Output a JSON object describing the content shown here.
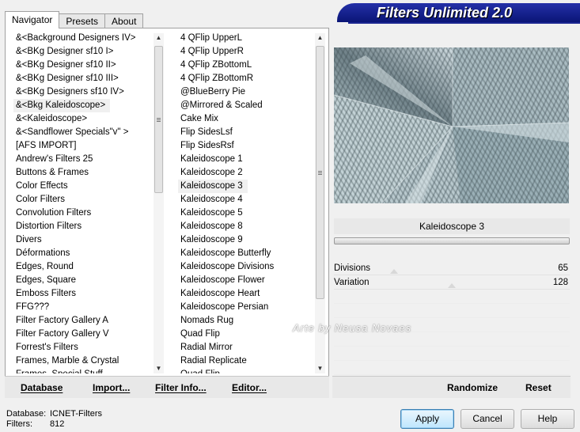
{
  "tabs": [
    "Navigator",
    "Presets",
    "About"
  ],
  "app_title": "Filters Unlimited 2.0",
  "categories": [
    "&<Background Designers IV>",
    "&<BKg Designer sf10 I>",
    "&<BKg Designer sf10 II>",
    "&<BKg Designer sf10 III>",
    "&<BKg Designers sf10 IV>",
    "&<Bkg Kaleidoscope>",
    "&<Kaleidoscope>",
    "&<Sandflower Specials\"v\" >",
    "[AFS IMPORT]",
    "Andrew's Filters 25",
    "Buttons & Frames",
    "Color Effects",
    "Color Filters",
    "Convolution Filters",
    "Distortion Filters",
    "Divers",
    "Déformations",
    "Edges, Round",
    "Edges, Square",
    "Emboss Filters",
    "FFG???",
    "Filter Factory Gallery A",
    "Filter Factory Gallery V",
    "Forrest's Filters",
    "Frames, Marble & Crystal",
    "Frames, Special Stuff"
  ],
  "selected_category": "&<Bkg Kaleidoscope>",
  "filters": [
    "4 QFlip UpperL",
    "4 QFlip UpperR",
    "4 QFlip ZBottomL",
    "4 QFlip ZBottomR",
    "@BlueBerry Pie",
    "@Mirrored & Scaled",
    "Cake Mix",
    "Flip SidesLsf",
    "Flip SidesRsf",
    "Kaleidoscope 1",
    "Kaleidoscope 2",
    "Kaleidoscope 3",
    "Kaleidoscope 4",
    "Kaleidoscope 5",
    "Kaleidoscope 8",
    "Kaleidoscope 9",
    "Kaleidoscope Butterfly",
    "Kaleidoscope Divisions",
    "Kaleidoscope Flower",
    "Kaleidoscope Heart",
    "Kaleidoscope Persian",
    "Nomads Rug",
    "Quad Flip",
    "Radial Mirror",
    "Radial Replicate",
    "Quad Flip"
  ],
  "selected_filter": "Kaleidoscope 3",
  "filter_name": "Kaleidoscope 3",
  "params": [
    {
      "label": "Divisions",
      "value": "65",
      "level": 0.254
    },
    {
      "label": "Variation",
      "value": "128",
      "level": 0.5
    }
  ],
  "watermark": "Arte by Neusa Novaes",
  "left_buttons": {
    "database": "Database",
    "import": "Import...",
    "filter_info": "Filter Info...",
    "editor": "Editor..."
  },
  "right_buttons": {
    "randomize": "Randomize",
    "reset": "Reset"
  },
  "status": {
    "database_label": "Database:",
    "database_value": "ICNET-Filters",
    "filters_label": "Filters:",
    "filters_value": "812"
  },
  "dialog_buttons": {
    "apply": "Apply",
    "cancel": "Cancel",
    "help": "Help"
  },
  "colors": {
    "banner": "#0a1576",
    "selection": "#f0f0f0"
  }
}
